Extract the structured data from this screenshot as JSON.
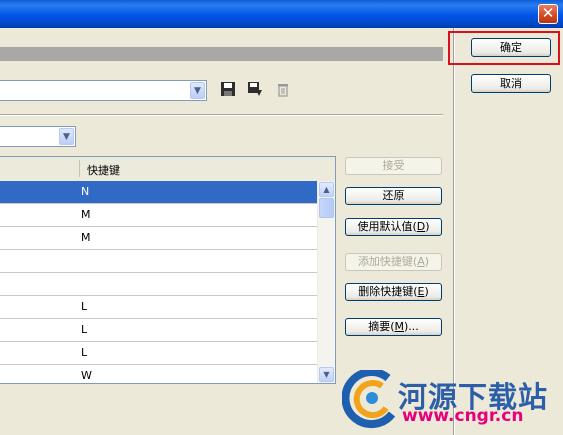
{
  "titlebar": {
    "close_glyph": "✕"
  },
  "toolbar": {
    "set_combo_value": "",
    "save_icon": "save-icon",
    "save_as_icon": "save-as-icon",
    "delete_icon": "trash-icon"
  },
  "second_combo": {
    "value": ""
  },
  "table": {
    "columns": [
      "",
      "快捷键"
    ],
    "rows": [
      {
        "name": "",
        "key": "N",
        "selected": true
      },
      {
        "name": "",
        "key": "M",
        "selected": false
      },
      {
        "name": "",
        "key": "M",
        "selected": false
      },
      {
        "name": "",
        "key": "",
        "selected": false
      },
      {
        "name": "",
        "key": "",
        "selected": false
      },
      {
        "name": "",
        "key": "L",
        "selected": false
      },
      {
        "name": "",
        "key": "L",
        "selected": false
      },
      {
        "name": "",
        "key": "L",
        "selected": false
      },
      {
        "name": "",
        "key": "W",
        "selected": false
      }
    ]
  },
  "side_buttons": {
    "accept": "接受",
    "restore": "还原",
    "use_default": "使用默认值(D)",
    "use_default_mnemonic": "D",
    "add_shortcut": "添加快捷键(A)",
    "add_shortcut_mnemonic": "A",
    "delete_shortcut": "删除快捷键(E)",
    "delete_shortcut_mnemonic": "E",
    "summary": "摘要(M)...",
    "summary_mnemonic": "M"
  },
  "dialog_buttons": {
    "ok": "确定",
    "cancel": "取消"
  },
  "watermark": {
    "name": "河源下载站",
    "url": "www.cngr.cn"
  },
  "colors": {
    "selection": "#316ac5",
    "highlight_box": "#d8121a",
    "title_blue": "#0055e5"
  }
}
